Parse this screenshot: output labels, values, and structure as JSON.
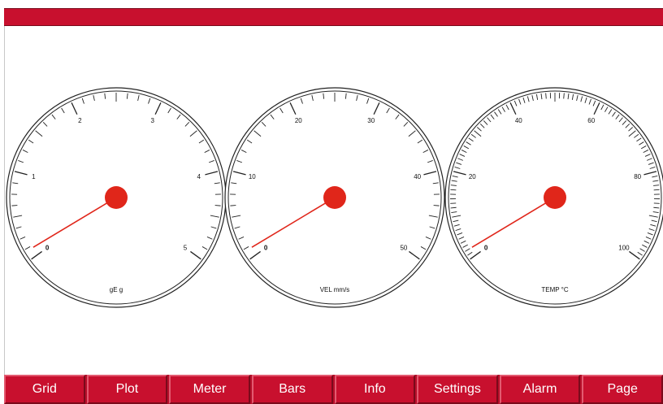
{
  "theme": {
    "accent": "#c8102e",
    "needle": "#e0261a",
    "hub": "#e0261a"
  },
  "gauges": [
    {
      "unit_label": "gE g",
      "min": 0,
      "max": 5,
      "major_labels": [
        "0",
        "1",
        "2",
        "3",
        "4",
        "5"
      ],
      "value": 0.1,
      "minor_per_major": 8
    },
    {
      "unit_label": "VEL mm/s",
      "min": 0,
      "max": 50,
      "major_labels": [
        "0",
        "10",
        "20",
        "30",
        "40",
        "50"
      ],
      "value": 1.0,
      "minor_per_major": 8
    },
    {
      "unit_label": "TEMP °C",
      "min": 0,
      "max": 100,
      "major_labels": [
        "0",
        "20",
        "40",
        "60",
        "80",
        "100"
      ],
      "value": 2.0,
      "minor_per_major": 20
    }
  ],
  "nav": {
    "items": [
      "Grid",
      "Plot",
      "Meter",
      "Bars",
      "Info",
      "Settings",
      "Alarm",
      "Page"
    ]
  }
}
